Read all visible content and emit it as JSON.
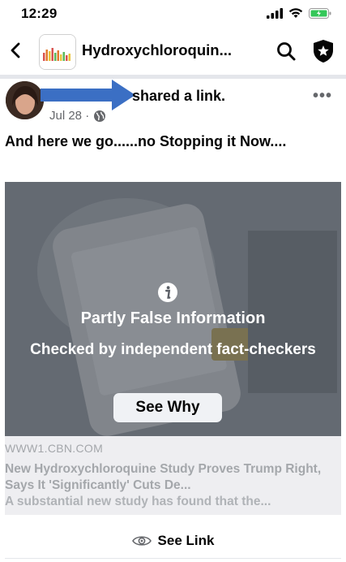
{
  "status_bar": {
    "time": "12:29"
  },
  "header": {
    "group_title": "Hydroxychloroquin..."
  },
  "post": {
    "action": "shared a link.",
    "date": "Jul 28 ·",
    "text": "And here we go......no Stopping it Now...."
  },
  "fact_check": {
    "title": "Partly False Information",
    "subtitle": "Checked by independent fact-checkers",
    "button_label": "See Why"
  },
  "link_preview": {
    "domain": "WWW1.CBN.COM",
    "title": "New Hydroxychloroquine Study Proves Trump Right, Says It 'Significantly' Cuts De...",
    "description": "A substantial new study has found that the..."
  },
  "footer": {
    "see_link_label": "See Link"
  },
  "colors": {
    "arrow": "#3b6fc4",
    "overlay": "#5a5e66",
    "muted_text": "#65676b"
  },
  "icons": [
    "back-arrow-icon",
    "search-icon",
    "shield-star-icon",
    "more-dots-icon",
    "globe-icon",
    "info-icon",
    "eye-icon",
    "signal-icon",
    "wifi-icon",
    "battery-icon"
  ]
}
